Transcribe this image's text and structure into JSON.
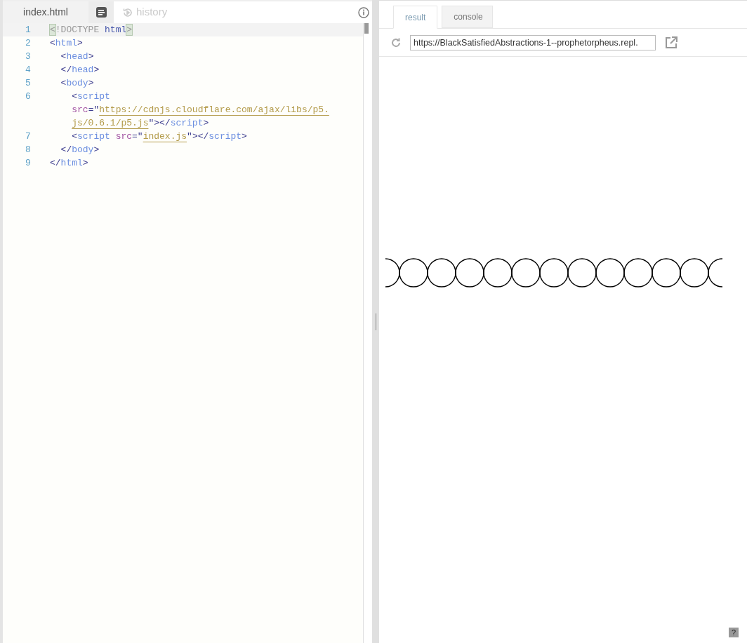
{
  "editor": {
    "file_tab": {
      "label": "index.html",
      "selected": true
    },
    "history_tab": {
      "label": "history",
      "selected": false
    },
    "lines": [
      {
        "number": "1",
        "tokens": [
          {
            "text": "<",
            "kind": "match"
          },
          {
            "text": "!DOCTYPE ",
            "kind": "doctype"
          },
          {
            "text": "html",
            "kind": "keyword"
          },
          {
            "text": ">",
            "kind": "match"
          }
        ]
      },
      {
        "number": "2",
        "tokens": [
          {
            "text": "<",
            "kind": "punct"
          },
          {
            "text": "html",
            "kind": "tag"
          },
          {
            "text": ">",
            "kind": "punct"
          }
        ]
      },
      {
        "number": "3",
        "tokens": [
          {
            "text": "  <",
            "kind": "punct"
          },
          {
            "text": "head",
            "kind": "tag"
          },
          {
            "text": ">",
            "kind": "punct"
          }
        ]
      },
      {
        "number": "4",
        "tokens": [
          {
            "text": "  </",
            "kind": "punct"
          },
          {
            "text": "head",
            "kind": "tag"
          },
          {
            "text": ">",
            "kind": "punct"
          }
        ]
      },
      {
        "number": "5",
        "tokens": [
          {
            "text": "  <",
            "kind": "punct"
          },
          {
            "text": "body",
            "kind": "tag"
          },
          {
            "text": ">",
            "kind": "punct"
          }
        ]
      },
      {
        "number": "6",
        "tokens": [
          {
            "text": "    <",
            "kind": "punct"
          },
          {
            "text": "script",
            "kind": "tag"
          }
        ]
      },
      {
        "tokens": [
          {
            "text": "    src",
            "kind": "attr"
          },
          {
            "text": "=\"",
            "kind": "punct"
          },
          {
            "text": "https://cdnjs.cloudflare.com/ajax/libs/p5.",
            "kind": "link"
          }
        ]
      },
      {
        "tokens": [
          {
            "text": "    js/0.6.1/p5.js",
            "kind": "link"
          },
          {
            "text": "\">",
            "kind": "punct"
          },
          {
            "text": "</",
            "kind": "punct"
          },
          {
            "text": "script",
            "kind": "tag"
          },
          {
            "text": ">",
            "kind": "punct"
          }
        ]
      },
      {
        "number": "7",
        "tokens": [
          {
            "text": "    <",
            "kind": "punct"
          },
          {
            "text": "script ",
            "kind": "tag"
          },
          {
            "text": "src",
            "kind": "attr"
          },
          {
            "text": "=\"",
            "kind": "punct"
          },
          {
            "text": "index.js",
            "kind": "link"
          },
          {
            "text": "\"></",
            "kind": "punct"
          },
          {
            "text": "script",
            "kind": "tag"
          },
          {
            "text": ">",
            "kind": "punct"
          }
        ]
      },
      {
        "number": "8",
        "tokens": [
          {
            "text": "  </",
            "kind": "punct"
          },
          {
            "text": "body",
            "kind": "tag"
          },
          {
            "text": ">",
            "kind": "punct"
          }
        ]
      },
      {
        "number": "9",
        "tokens": [
          {
            "text": "</",
            "kind": "punct"
          },
          {
            "text": "html",
            "kind": "tag"
          },
          {
            "text": ">",
            "kind": "punct"
          }
        ]
      }
    ]
  },
  "preview": {
    "tabs": [
      {
        "label": "result",
        "selected": true
      },
      {
        "label": "console",
        "selected": false
      }
    ],
    "url": "https://BlackSatisfiedAbstractions-1--prophetorpheus.repl.",
    "help": "?"
  }
}
